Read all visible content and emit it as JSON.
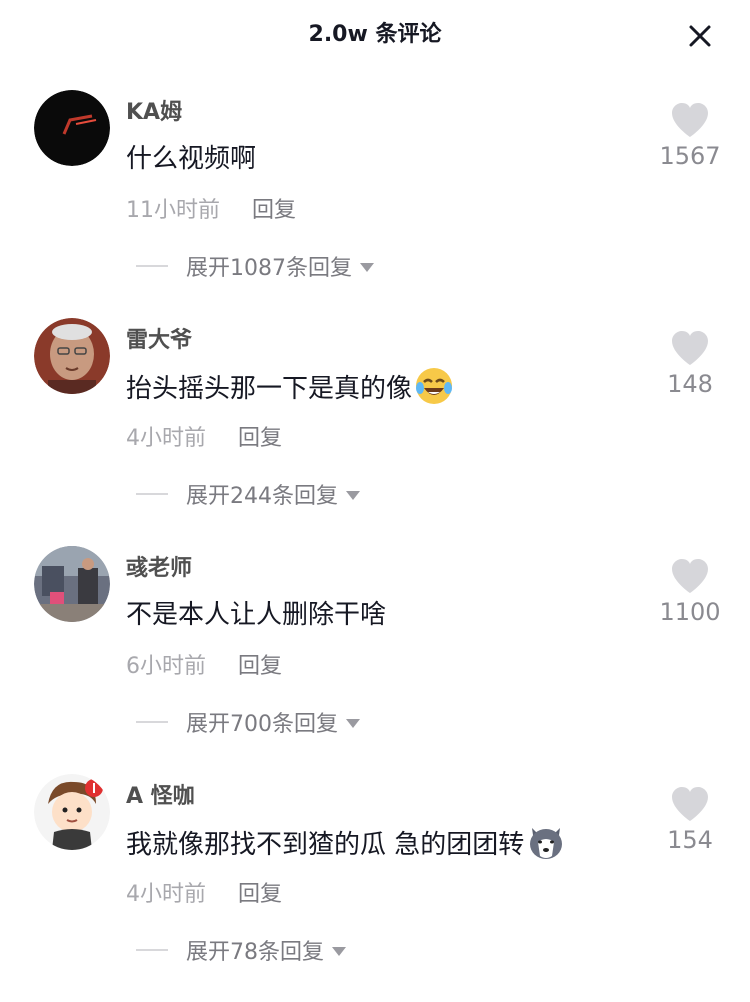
{
  "header": {
    "title": "2.0w 条评论"
  },
  "comments": [
    {
      "username": "KA姆",
      "text": "什么视频啊",
      "time": "11小时前",
      "reply": "回复",
      "expand": "展开1087条回复",
      "likes": "1567",
      "emoji": ""
    },
    {
      "username": "雷大爷",
      "text": "抬头摇头那一下是真的像",
      "time": "4小时前",
      "reply": "回复",
      "expand": "展开244条回复",
      "likes": "148",
      "emoji": "laughing-crying-emoji"
    },
    {
      "username": "彧老师",
      "text": "不是本人让人删除干啥",
      "time": "6小时前",
      "reply": "回复",
      "expand": "展开700条回复",
      "likes": "1100",
      "emoji": ""
    },
    {
      "username": "A  怪咖",
      "text": "我就像那找不到猹的瓜 急的团团转",
      "time": "4小时前",
      "reply": "回复",
      "expand": "展开78条回复",
      "likes": "154",
      "emoji": "husky-dog-emoji"
    }
  ],
  "colors": {
    "heart": "#d6d6da",
    "text": "#161823",
    "secondary": "#a8a8ad"
  }
}
